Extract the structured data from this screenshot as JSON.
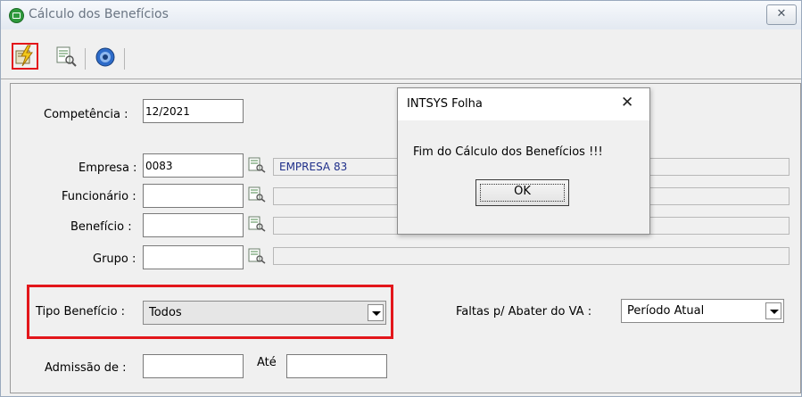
{
  "window": {
    "title": "Cálculo dos Benefícios",
    "close_glyph": "✕"
  },
  "toolbar": {
    "buttons": [
      {
        "icon": "lightning-calc-icon"
      },
      {
        "icon": "search-doc-icon"
      },
      {
        "icon": "help-info-icon"
      }
    ]
  },
  "form": {
    "competencia": {
      "label": "Competência :",
      "value": "12/2021"
    },
    "empresa": {
      "label": "Empresa :",
      "value": "0083",
      "description": "EMPRESA 83"
    },
    "funcionario": {
      "label": "Funcionário :",
      "value": "",
      "description": ""
    },
    "beneficio": {
      "label": "Benefício :",
      "value": "",
      "description": ""
    },
    "grupo": {
      "label": "Grupo :",
      "value": "",
      "description": ""
    },
    "tipo_beneficio": {
      "label": "Tipo Benefício :",
      "selected": "Todos"
    },
    "faltas": {
      "label": "Faltas p/ Abater do VA :",
      "selected": "Período Atual"
    },
    "admissao": {
      "label": "Admissão de :",
      "value": "",
      "ate_label": "Até",
      "ate_value": ""
    }
  },
  "dialog": {
    "title": "INTSYS Folha",
    "close_glyph": "✕",
    "message": "Fim do Cálculo dos Benefícios !!!",
    "ok_label": "OK"
  },
  "colors": {
    "highlight": "#e3161b",
    "description_text": "#1f2f8a"
  }
}
